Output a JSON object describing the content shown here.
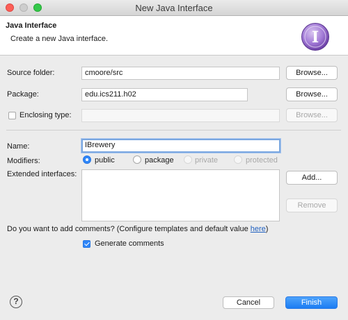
{
  "window": {
    "title": "New Java Interface"
  },
  "banner": {
    "title": "Java Interface",
    "description": "Create a new Java interface."
  },
  "source_folder": {
    "label": "Source folder:",
    "value": "cmoore/src",
    "browse": "Browse..."
  },
  "package": {
    "label": "Package:",
    "value": "edu.ics211.h02",
    "browse": "Browse..."
  },
  "enclosing_type": {
    "label": "Enclosing type:",
    "value": "",
    "browse": "Browse...",
    "checked": false
  },
  "name": {
    "label": "Name:",
    "value": "IBrewery"
  },
  "modifiers": {
    "label": "Modifiers:",
    "options": [
      "public",
      "package",
      "private",
      "protected"
    ],
    "selected": "public"
  },
  "extended_interfaces": {
    "label": "Extended interfaces:",
    "add": "Add...",
    "remove": "Remove"
  },
  "comments": {
    "question": "Do you want to add comments? (Configure templates and default value ",
    "link": "here",
    "close_paren": ")",
    "generate_label": "Generate comments",
    "generate_checked": true
  },
  "footer": {
    "help": "?",
    "cancel": "Cancel",
    "finish": "Finish"
  },
  "icons": {
    "interface": "interface-icon",
    "help": "help-icon"
  },
  "colors": {
    "accent": "#1b7cf3",
    "interface_badge": "#8e5cc6"
  }
}
